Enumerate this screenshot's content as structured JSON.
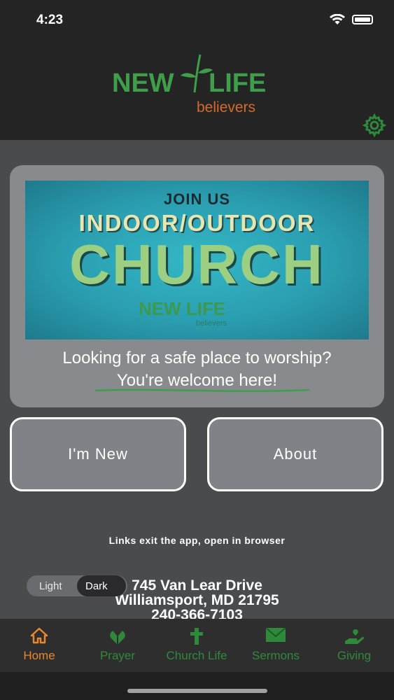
{
  "status": {
    "time": "4:23"
  },
  "header": {
    "logo_new": "NEW",
    "logo_life": "LIFE",
    "logo_believers": "believers"
  },
  "card": {
    "banner": {
      "join": "JOIN US",
      "headline": "INDOOR/OUTDOOR",
      "church": "CHURCH",
      "logo_text": "NEW LIFE",
      "logo_sub": "believers"
    },
    "line1": "Looking for a safe place to worship?",
    "line2": "You're welcome here!"
  },
  "buttons": {
    "new_label": "I'm New",
    "about_label": "About"
  },
  "links_note": "Links exit the app, open in browser",
  "theme_toggle": {
    "light": "Light",
    "dark": "Dark",
    "selected": "Dark"
  },
  "contact": {
    "street": "745 Van Lear Drive",
    "city": "Williamsport, MD 21795",
    "phone": "240-366-7103"
  },
  "tabs": [
    {
      "label": "Home",
      "icon": "home-icon",
      "active": true
    },
    {
      "label": "Prayer",
      "icon": "praying-hands-icon",
      "active": false
    },
    {
      "label": "Church Life",
      "icon": "cross-icon",
      "active": false
    },
    {
      "label": "Sermons",
      "icon": "envelope-icon",
      "active": false
    },
    {
      "label": "Giving",
      "icon": "giving-hand-icon",
      "active": false
    }
  ],
  "colors": {
    "brand_green": "#3e9e4a",
    "brand_orange": "#d46a2a",
    "tab_active": "#e8872d",
    "tab_inactive": "#2e8a3a"
  }
}
